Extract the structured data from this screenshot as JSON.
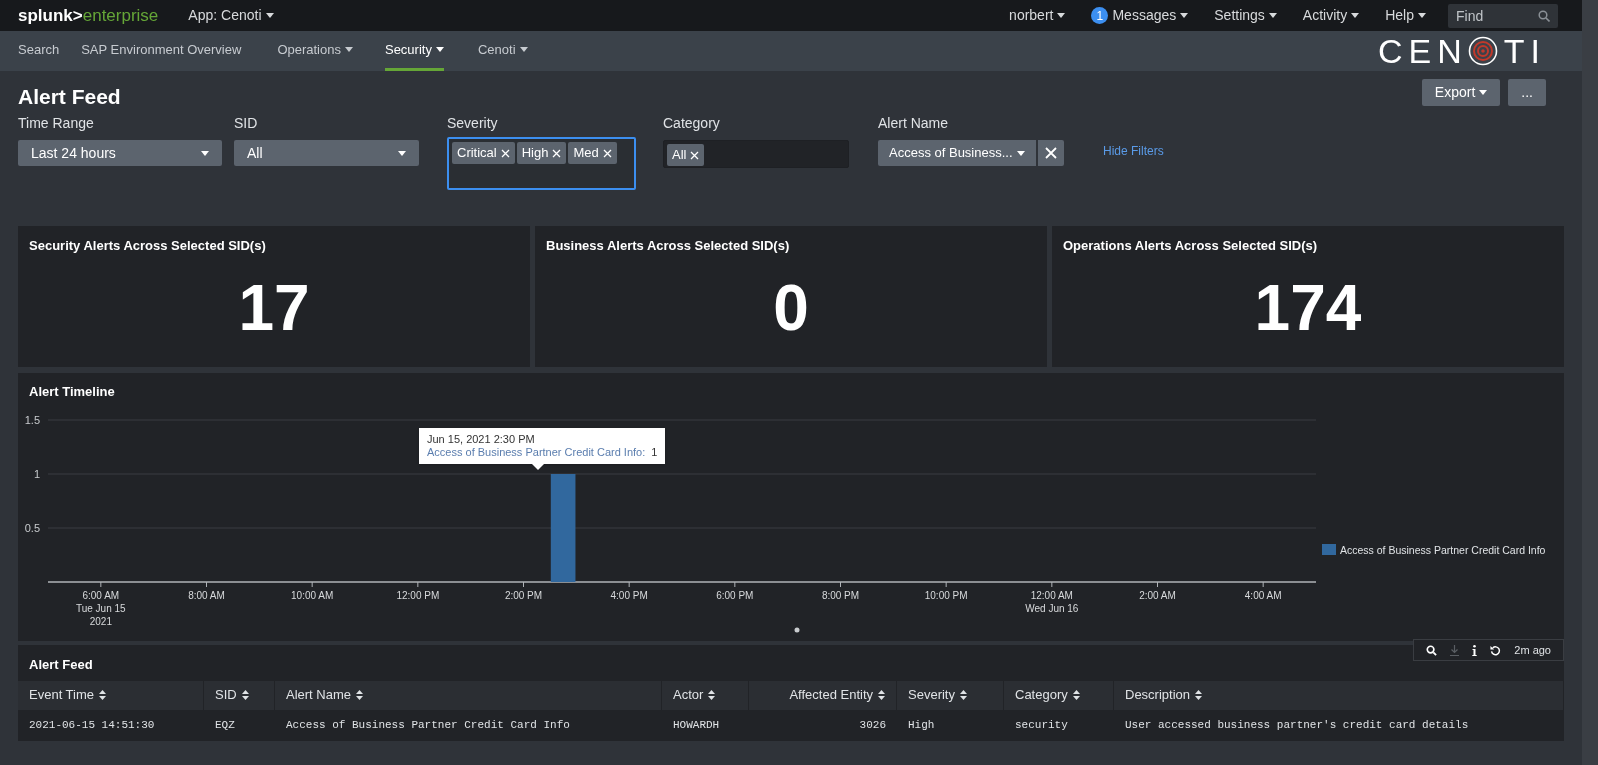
{
  "top_bar": {
    "brand": "splunk>",
    "product": "enterprise",
    "app_menu": "App: Cenoti",
    "menus": [
      {
        "label": "norbert"
      },
      {
        "label": "Messages",
        "badge": "1"
      },
      {
        "label": "Settings"
      },
      {
        "label": "Activity"
      },
      {
        "label": "Help"
      }
    ],
    "search": {
      "placeholder": "Find"
    }
  },
  "nav": {
    "items": [
      {
        "label": "Search",
        "dropdown": false,
        "selected": false
      },
      {
        "label": "SAP Environment Overview",
        "dropdown": false,
        "selected": false
      },
      {
        "label": "Operations",
        "dropdown": true,
        "selected": false
      },
      {
        "label": "Security",
        "dropdown": true,
        "selected": true
      },
      {
        "label": "Cenoti",
        "dropdown": true,
        "selected": false
      }
    ],
    "logo": {
      "before": "CEN",
      "after": "TI"
    }
  },
  "page": {
    "title": "Alert Feed",
    "buttons": [
      {
        "label": "Export",
        "dropdown": true
      },
      {
        "label": "...",
        "dropdown": false
      }
    ]
  },
  "filters": [
    {
      "kind": "dropdown",
      "label": "Time Range",
      "value": "Last 24 hours"
    },
    {
      "kind": "dropdown",
      "label": "SID",
      "value": "All"
    },
    {
      "kind": "multiselect",
      "label": "Severity",
      "tokens": [
        "Critical",
        "High",
        "Med"
      ],
      "focused": true
    },
    {
      "kind": "multiselect",
      "label": "Category",
      "tokens": [
        "All"
      ],
      "focused": false
    },
    {
      "kind": "clearable",
      "label": "Alert Name",
      "value": "Access of Business..."
    }
  ],
  "hide_filters_link": "Hide Filters",
  "stat_panels": [
    {
      "title": "Security Alerts Across Selected SID(s)",
      "value": "17"
    },
    {
      "title": "Business Alerts Across Selected SID(s)",
      "value": "0"
    },
    {
      "title": "Operations Alerts Across Selected SID(s)",
      "value": "174"
    }
  ],
  "timeline": {
    "title": "Alert Timeline",
    "chart_data": {
      "type": "bar",
      "x": [
        "2021-06-15 14:45"
      ],
      "series": [
        {
          "name": "Access of Business Partner Credit Card Info",
          "color": "#31689e",
          "values": [
            1
          ]
        }
      ],
      "xlim": [
        "2021-06-15 05:00",
        "2021-06-16 05:00"
      ],
      "ylim": [
        0,
        1.5
      ],
      "yticks": [
        {
          "value": 0.5,
          "label": "0.5"
        },
        {
          "value": 1,
          "label": "1"
        },
        {
          "value": 1.5,
          "label": "1.5"
        }
      ],
      "xticks": [
        {
          "value": "2021-06-15 06:00",
          "label": "6:00 AM\nTue Jun 15\n2021"
        },
        {
          "value": "2021-06-15 08:00",
          "label": "8:00 AM"
        },
        {
          "value": "2021-06-15 10:00",
          "label": "10:00 AM"
        },
        {
          "value": "2021-06-15 12:00",
          "label": "12:00 PM"
        },
        {
          "value": "2021-06-15 14:00",
          "label": "2:00 PM"
        },
        {
          "value": "2021-06-15 16:00",
          "label": "4:00 PM"
        },
        {
          "value": "2021-06-15 18:00",
          "label": "6:00 PM"
        },
        {
          "value": "2021-06-15 20:00",
          "label": "8:00 PM"
        },
        {
          "value": "2021-06-15 22:00",
          "label": "10:00 PM"
        },
        {
          "value": "2021-06-16 00:00",
          "label": "12:00 AM\nWed Jun 16"
        },
        {
          "value": "2021-06-16 02:00",
          "label": "2:00 AM"
        },
        {
          "value": "2021-06-16 04:00",
          "label": "4:00 AM"
        }
      ]
    },
    "tooltip": {
      "time": "Jun 15, 2021 2:30 PM",
      "series": "Access of Business Partner Credit Card Info:",
      "value": "1"
    },
    "footer": {
      "download_disabled": true,
      "updated": "2m ago"
    }
  },
  "alert_feed": {
    "title": "Alert Feed",
    "columns": [
      {
        "label": "Event Time",
        "kind": "text"
      },
      {
        "label": "SID",
        "kind": "text"
      },
      {
        "label": "Alert Name",
        "kind": "text"
      },
      {
        "label": "Actor",
        "kind": "text"
      },
      {
        "label": "Affected Entity",
        "kind": "number"
      },
      {
        "label": "Severity",
        "kind": "text"
      },
      {
        "label": "Category",
        "kind": "text"
      },
      {
        "label": "Description",
        "kind": "text"
      }
    ],
    "rows": [
      [
        "2021-06-15 14:51:30",
        "EQZ",
        "Access of Business Partner Credit Card Info",
        "HOWARDH",
        "3026",
        "High",
        "security",
        "User accessed business partner's credit card details"
      ]
    ]
  }
}
